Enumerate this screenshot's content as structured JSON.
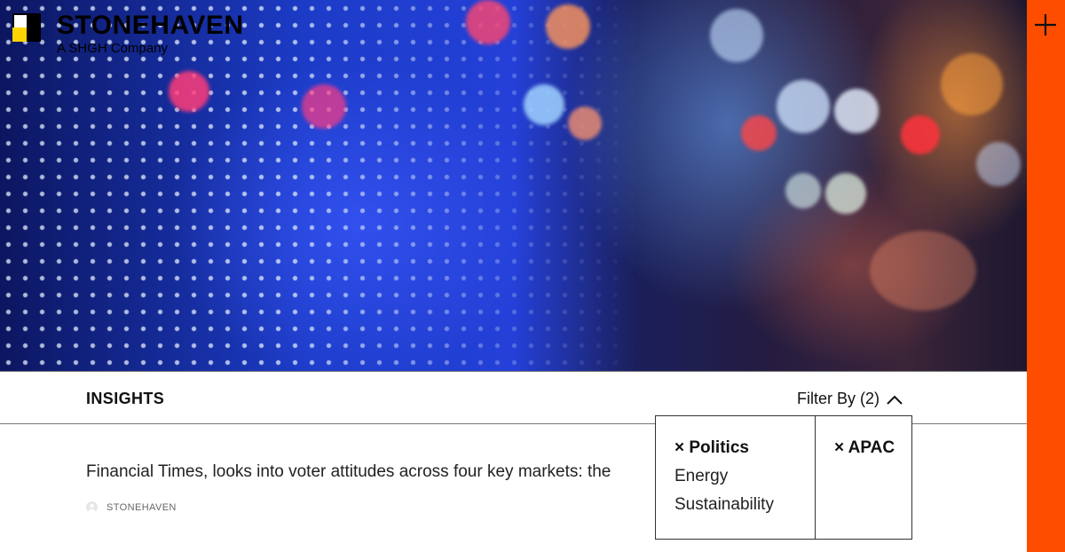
{
  "brand": {
    "name": "STONEHAVEN",
    "tagline": "A SHGH Company"
  },
  "insights_bar": {
    "title": "INSIGHTS",
    "filter_label": "Filter By (2)"
  },
  "article": {
    "excerpt": "Financial Times, looks into voter attitudes across four key markets: the",
    "author": "STONEHAVEN"
  },
  "filter_dropdown": {
    "topics": [
      {
        "label": "× Politics",
        "selected": true
      },
      {
        "label": "Energy",
        "selected": false
      },
      {
        "label": "Sustainability",
        "selected": false
      }
    ],
    "regions": [
      {
        "label": "× APAC",
        "selected": true
      }
    ]
  },
  "colors": {
    "accent": "#ff4d00"
  },
  "icons": {
    "menu": "plus-icon",
    "filter_toggle": "chevron-up-icon"
  }
}
